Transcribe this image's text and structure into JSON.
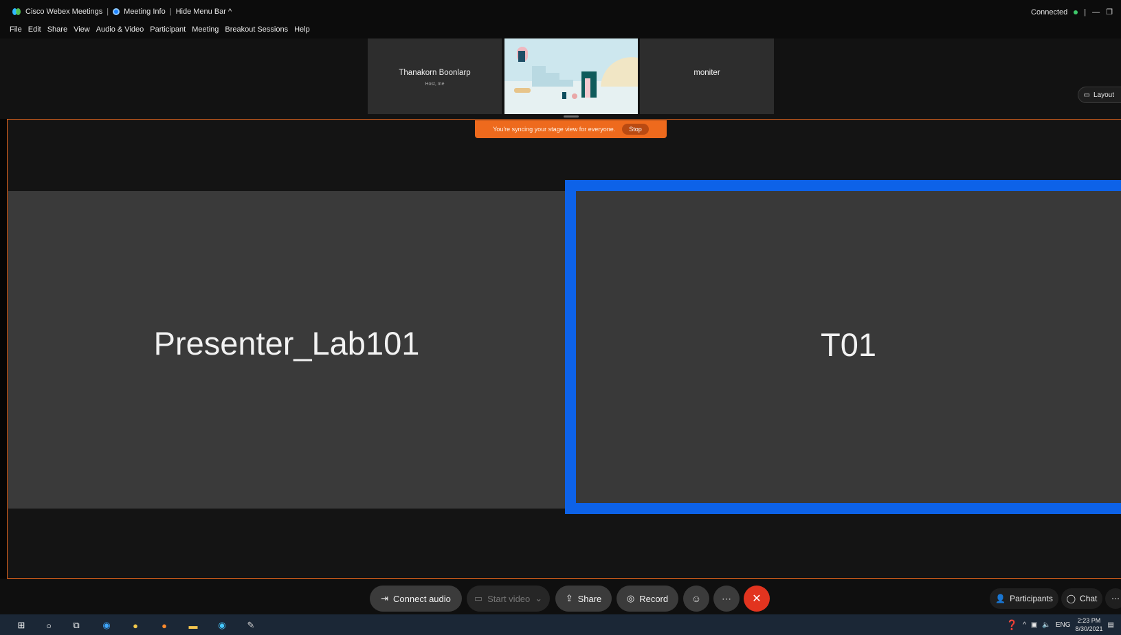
{
  "titlebar": {
    "app_name": "Cisco Webex Meetings",
    "meeting_info": "Meeting Info",
    "hide_menu_bar": "Hide Menu Bar",
    "connection_status": "Connected",
    "icons": [
      "webex-logo-icon",
      "info-icon",
      "chevron-up-icon",
      "minimize-icon",
      "restore-icon"
    ]
  },
  "menu": {
    "items": [
      "File",
      "Edit",
      "Share",
      "View",
      "Audio & Video",
      "Participant",
      "Meeting",
      "Breakout Sessions",
      "Help"
    ]
  },
  "thumbnails": [
    {
      "name": "Thanakorn Boonlarp",
      "subtitle": "Host, me"
    },
    {
      "name": ""
    },
    {
      "name": "moniter"
    }
  ],
  "layout_button": {
    "label": "Layout"
  },
  "sync_banner": {
    "message": "You're syncing your stage view for everyone.",
    "stop_label": "Stop"
  },
  "stage": {
    "tiles": [
      {
        "name": "Presenter_Lab101",
        "active_speaker": false
      },
      {
        "name": "T01",
        "active_speaker": true
      }
    ]
  },
  "controls": {
    "connect_audio": "Connect audio",
    "start_video": "Start video",
    "share": "Share",
    "record": "Record",
    "reactions_icon": "smiley-icon",
    "more_icon": "ellipsis-icon",
    "end_icon": "close-icon",
    "participants": "Participants",
    "chat": "Chat"
  },
  "taskbar": {
    "language": "ENG",
    "time": "2:23 PM",
    "date": "8/30/2021"
  },
  "colors": {
    "accent_orange": "#ee6a1d",
    "active_speaker_blue": "#0d62e8",
    "end_red": "#e2341f",
    "connected_green": "#3ec96b"
  }
}
